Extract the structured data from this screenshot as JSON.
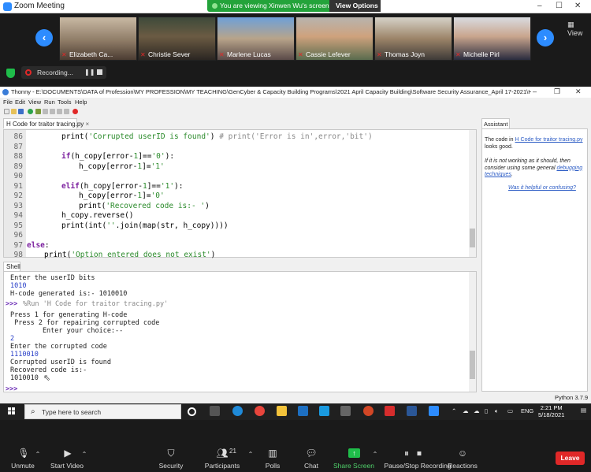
{
  "zoom": {
    "window_title": "Zoom Meeting",
    "viewing_banner": "You are viewing Xinwen Wu's screen",
    "view_options": "View Options",
    "view_label": "View",
    "recording_label": "Recording...",
    "participants": [
      {
        "name": "Elizabeth Ca..."
      },
      {
        "name": "Christie Sever"
      },
      {
        "name": "Marlene Lucas"
      },
      {
        "name": "Cassie Lefever"
      },
      {
        "name": "Thomas Joyn"
      },
      {
        "name": "Michelle Pirl"
      }
    ],
    "controls": {
      "unmute": "Unmute",
      "start_video": "Start Video",
      "security": "Security",
      "participants": "Participants",
      "participants_count": "21",
      "polls": "Polls",
      "chat": "Chat",
      "share_screen": "Share Screen",
      "pause_recording": "Pause/Stop Recording",
      "reactions": "Reactions",
      "leave": "Leave"
    }
  },
  "thonny": {
    "title": "Thonny  -  E:\\DOCUMENTS\\DATA of Profession\\MY PROFESSION\\MY TEACHING\\GenCyber & Capacity Building Programs\\2021 April Capacity Building\\Software Security Assurance_April 17-2021\\H Code for tra...",
    "menu": [
      "File",
      "Edit",
      "View",
      "Run",
      "Tools",
      "Help"
    ],
    "editor_tab": "H Code for traitor tracing.py",
    "line_numbers": [
      "86",
      "87",
      "88",
      "89",
      "90",
      "91",
      "92",
      "93",
      "94",
      "95",
      "96",
      "97",
      "98"
    ],
    "code": {
      "l86_a": "print(",
      "l86_s": "'Corrupted userID is found'",
      "l86_b": ") ",
      "l86_c": "# print('Error is in',error,'bit')",
      "l88_k": "if",
      "l88_a": "(h_copy[error-",
      "l88_n": "1",
      "l88_b": "]==",
      "l88_s": "'0'",
      "l88_c": "):",
      "l89_a": "h_copy[error-",
      "l89_n": "1",
      "l89_b": "]=",
      "l89_s": "'1'",
      "l91_k": "elif",
      "l91_a": "(h_copy[error-",
      "l91_n": "1",
      "l91_b": "]==",
      "l91_s": "'1'",
      "l91_c": "):",
      "l92_a": "h_copy[error-",
      "l92_n": "1",
      "l92_b": "]=",
      "l92_s": "'0'",
      "l93_a": "print(",
      "l93_s": "'Recovered code is:- '",
      "l93_b": ")",
      "l94": "h_copy.reverse()",
      "l95_a": "print(int(",
      "l95_s": "''",
      "l95_b": ".join(map(str, h_copy))))",
      "l97_k": "else",
      "l97_b": ":",
      "l98_a": "print(",
      "l98_s": "'Option entered does not exist'",
      "l98_b": ")"
    },
    "shell_tab": "Shell",
    "shell_lines": [
      {
        "t": "Enter the userID bits",
        "c": "out"
      },
      {
        "t": "1010",
        "c": "in"
      },
      {
        "t": "H-code generated is:- 1010010",
        "c": "out"
      },
      {
        "t": ">>> ",
        "c": "prompt"
      },
      {
        "t": "%Run 'H Code for traitor tracing.py'",
        "c": "runcmd"
      },
      {
        "t": "Press 1 for generating H-code",
        "c": "out"
      },
      {
        "t": " Press 2 for repairing corrupted code",
        "c": "out"
      },
      {
        "t": "        Enter your choice:--",
        "c": "out"
      },
      {
        "t": "2",
        "c": "in"
      },
      {
        "t": "Enter the corrupted code",
        "c": "out"
      },
      {
        "t": "1110010",
        "c": "in"
      },
      {
        "t": "Corrupted userID is found",
        "c": "out"
      },
      {
        "t": "Recovered code is:-",
        "c": "out"
      },
      {
        "t": "1010010",
        "c": "out"
      },
      {
        "t": ">>>",
        "c": "prompt"
      }
    ],
    "assistant": {
      "tab": "Assistant",
      "p1_a": "The code in ",
      "p1_link": "H Code for traitor tracing.py",
      "p1_b": " looks good.",
      "p2_a": "If it is not working as it should, then consider using some general ",
      "p2_link": "debugging techniques",
      "p2_b": ".",
      "feedback": "Was it helpful or confusing?"
    },
    "python_version": "Python 3.7.9"
  },
  "taskbar": {
    "search_placeholder": "Type here to search",
    "language": "ENG",
    "time": "2:21 PM",
    "date": "5/18/2021"
  },
  "colors": {
    "zoom_blue": "#2d8cff",
    "banner_green": "#23a33a",
    "leave_red": "#e02828",
    "keyword": "#7b1f9e",
    "string": "#2a8a2a"
  }
}
